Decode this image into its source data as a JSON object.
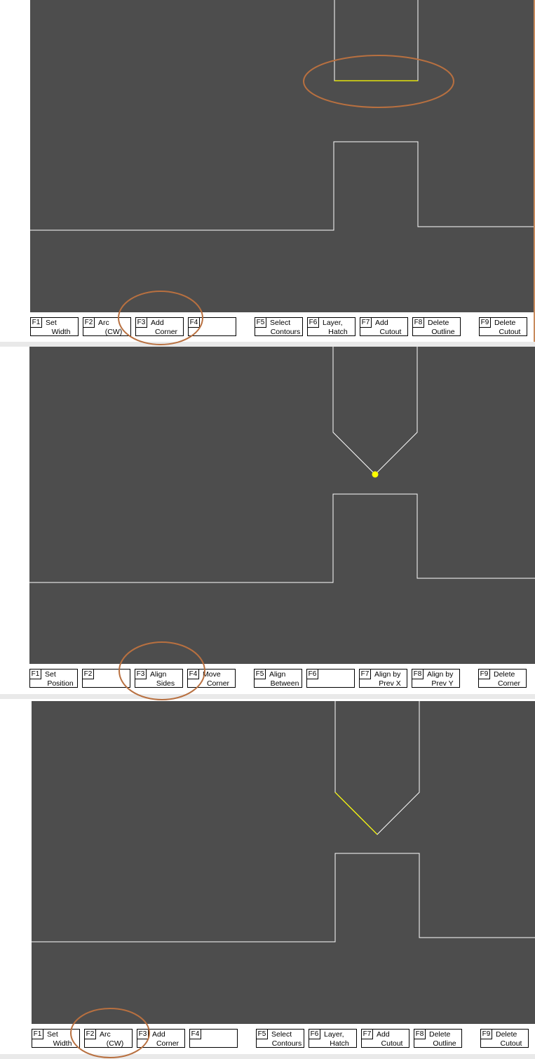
{
  "colors": {
    "canvas": "#4d4d4d",
    "outline": "#ffffff",
    "selection": "#ffff00",
    "annotation": "#b87040",
    "button_border": "#000000"
  },
  "panels": [
    {
      "fkeys": [
        {
          "key": "F1",
          "line1": "Set",
          "line2": "Width"
        },
        {
          "key": "F2",
          "line1": "Arc",
          "line2": "(CW)"
        },
        {
          "key": "F3",
          "line1": "Add",
          "line2": "Corner"
        },
        {
          "key": "F4",
          "line1": "",
          "line2": ""
        },
        {
          "key": "F5",
          "line1": "Select",
          "line2": "Contours"
        },
        {
          "key": "F6",
          "line1": "Layer,",
          "line2": "Hatch"
        },
        {
          "key": "F7",
          "line1": "Add",
          "line2": "Cutout"
        },
        {
          "key": "F8",
          "line1": "Delete",
          "line2": "Outline"
        },
        {
          "key": "F9",
          "line1": "Delete",
          "line2": "Cutout"
        }
      ]
    },
    {
      "fkeys": [
        {
          "key": "F1",
          "line1": "Set",
          "line2": "Position"
        },
        {
          "key": "F2",
          "line1": "",
          "line2": ""
        },
        {
          "key": "F3",
          "line1": "Align",
          "line2": "Sides"
        },
        {
          "key": "F4",
          "line1": "Move",
          "line2": "Corner"
        },
        {
          "key": "F5",
          "line1": "Align",
          "line2": "Between"
        },
        {
          "key": "F6",
          "line1": "",
          "line2": ""
        },
        {
          "key": "F7",
          "line1": "Align by",
          "line2": "Prev X"
        },
        {
          "key": "F8",
          "line1": "Align by",
          "line2": "Prev Y"
        },
        {
          "key": "F9",
          "line1": "Delete",
          "line2": "Corner"
        }
      ]
    },
    {
      "fkeys": [
        {
          "key": "F1",
          "line1": "Set",
          "line2": "Width"
        },
        {
          "key": "F2",
          "line1": "Arc",
          "line2": "(CW)"
        },
        {
          "key": "F3",
          "line1": "Add",
          "line2": "Corner"
        },
        {
          "key": "F4",
          "line1": "",
          "line2": ""
        },
        {
          "key": "F5",
          "line1": "Select",
          "line2": "Contours"
        },
        {
          "key": "F6",
          "line1": "Layer,",
          "line2": "Hatch"
        },
        {
          "key": "F7",
          "line1": "Add",
          "line2": "Cutout"
        },
        {
          "key": "F8",
          "line1": "Delete",
          "line2": "Outline"
        },
        {
          "key": "F9",
          "line1": "Delete",
          "line2": "Cutout"
        }
      ]
    }
  ]
}
